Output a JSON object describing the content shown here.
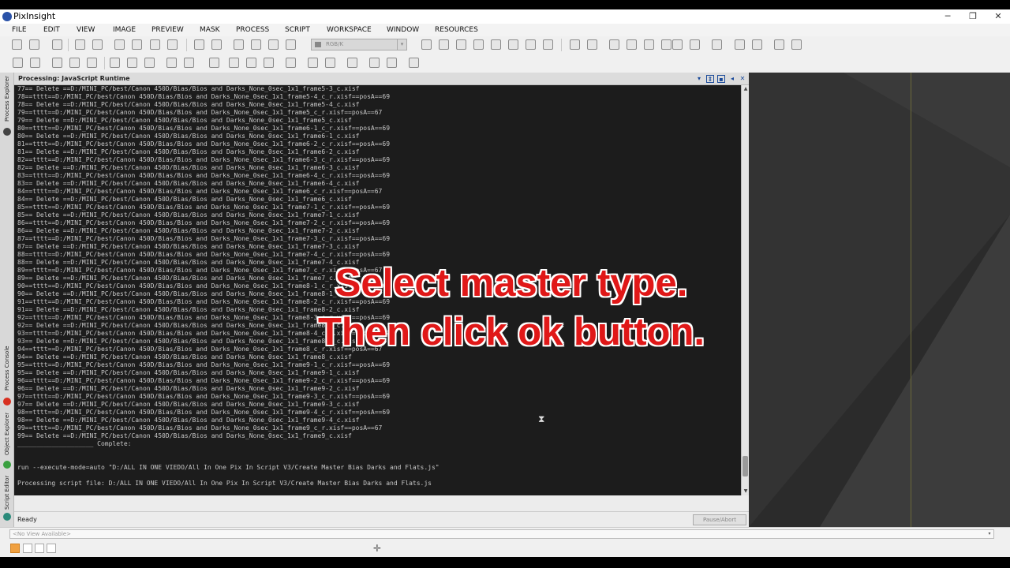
{
  "app": {
    "title": "PixInsight"
  },
  "menu": [
    "FILE",
    "EDIT",
    "VIEW",
    "IMAGE",
    "PREVIEW",
    "MASK",
    "PROCESS",
    "SCRIPT",
    "WORKSPACE",
    "WINDOW",
    "RESOURCES"
  ],
  "toolbar": {
    "color_space": "RGB/K"
  },
  "left_tabs": [
    "Process Explorer",
    "Process Console",
    "Object Explorer",
    "Script Editor"
  ],
  "panel": {
    "title": "Processing: JavaScript Runtime"
  },
  "console_lines": [
    "77== Delete ==D:/MINI_PC/best/Canon 450D/Bias/Bios and Darks_None_0sec_1x1_frame5-3_c.xisf",
    "78==tttt==D:/MINI_PC/best/Canon 450D/Bias/Bios and Darks_None_0sec_1x1_frame5-4_c_r.xisf==posA==69",
    "78== Delete ==D:/MINI_PC/best/Canon 450D/Bias/Bios and Darks_None_0sec_1x1_frame5-4_c.xisf",
    "79==tttt==D:/MINI_PC/best/Canon 450D/Bias/Bios and Darks_None_0sec_1x1_frame5_c_r.xisf==posA==67",
    "79== Delete ==D:/MINI_PC/best/Canon 450D/Bias/Bios and Darks_None_0sec_1x1_frame5_c.xisf",
    "80==tttt==D:/MINI_PC/best/Canon 450D/Bias/Bios and Darks_None_0sec_1x1_frame6-1_c_r.xisf==posA==69",
    "80== Delete ==D:/MINI_PC/best/Canon 450D/Bias/Bios and Darks_None_0sec_1x1_frame6-1_c.xisf",
    "81==tttt==D:/MINI_PC/best/Canon 450D/Bias/Bios and Darks_None_0sec_1x1_frame6-2_c_r.xisf==posA==69",
    "81== Delete ==D:/MINI_PC/best/Canon 450D/Bias/Bios and Darks_None_0sec_1x1_frame6-2_c.xisf",
    "82==tttt==D:/MINI_PC/best/Canon 450D/Bias/Bios and Darks_None_0sec_1x1_frame6-3_c_r.xisf==posA==69",
    "82== Delete ==D:/MINI_PC/best/Canon 450D/Bias/Bios and Darks_None_0sec_1x1_frame6-3_c.xisf",
    "83==tttt==D:/MINI_PC/best/Canon 450D/Bias/Bios and Darks_None_0sec_1x1_frame6-4_c_r.xisf==posA==69",
    "83== Delete ==D:/MINI_PC/best/Canon 450D/Bias/Bios and Darks_None_0sec_1x1_frame6-4_c.xisf",
    "84==tttt==D:/MINI_PC/best/Canon 450D/Bias/Bios and Darks_None_0sec_1x1_frame6_c_r.xisf==posA==67",
    "84== Delete ==D:/MINI_PC/best/Canon 450D/Bias/Bios and Darks_None_0sec_1x1_frame6_c.xisf",
    "85==tttt==D:/MINI_PC/best/Canon 450D/Bias/Bios and Darks_None_0sec_1x1_frame7-1_c_r.xisf==posA==69",
    "85== Delete ==D:/MINI_PC/best/Canon 450D/Bias/Bios and Darks_None_0sec_1x1_frame7-1_c.xisf",
    "86==tttt==D:/MINI_PC/best/Canon 450D/Bias/Bios and Darks_None_0sec_1x1_frame7-2_c_r.xisf==posA==69",
    "86== Delete ==D:/MINI_PC/best/Canon 450D/Bias/Bios and Darks_None_0sec_1x1_frame7-2_c.xisf",
    "87==tttt==D:/MINI_PC/best/Canon 450D/Bias/Bios and Darks_None_0sec_1x1_frame7-3_c_r.xisf==posA==69",
    "87== Delete ==D:/MINI_PC/best/Canon 450D/Bias/Bios and Darks_None_0sec_1x1_frame7-3_c.xisf",
    "88==tttt==D:/MINI_PC/best/Canon 450D/Bias/Bios and Darks_None_0sec_1x1_frame7-4_c_r.xisf==posA==69",
    "88== Delete ==D:/MINI_PC/best/Canon 450D/Bias/Bios and Darks_None_0sec_1x1_frame7-4_c.xisf",
    "89==tttt==D:/MINI_PC/best/Canon 450D/Bias/Bios and Darks_None_0sec_1x1_frame7_c_r.xisf==posA==67",
    "89== Delete ==D:/MINI_PC/best/Canon 450D/Bias/Bios and Darks_None_0sec_1x1_frame7_c.xisf",
    "90==tttt==D:/MINI_PC/best/Canon 450D/Bias/Bios and Darks_None_0sec_1x1_frame8-1_c_r.xisf==posA==69",
    "90== Delete ==D:/MINI_PC/best/Canon 450D/Bias/Bios and Darks_None_0sec_1x1_frame8-1_c.xisf",
    "91==tttt==D:/MINI_PC/best/Canon 450D/Bias/Bios and Darks_None_0sec_1x1_frame8-2_c_r.xisf==posA==69",
    "91== Delete ==D:/MINI_PC/best/Canon 450D/Bias/Bios and Darks_None_0sec_1x1_frame8-2_c.xisf",
    "92==tttt==D:/MINI_PC/best/Canon 450D/Bias/Bios and Darks_None_0sec_1x1_frame8-3_c_r.xisf==posA==69",
    "92== Delete ==D:/MINI_PC/best/Canon 450D/Bias/Bios and Darks_None_0sec_1x1_frame8-3_c.xisf",
    "93==tttt==D:/MINI_PC/best/Canon 450D/Bias/Bios and Darks_None_0sec_1x1_frame8-4_c_r.xisf==posA==69",
    "93== Delete ==D:/MINI_PC/best/Canon 450D/Bias/Bios and Darks_None_0sec_1x1_frame8-4_c.xisf",
    "94==tttt==D:/MINI_PC/best/Canon 450D/Bias/Bios and Darks_None_0sec_1x1_frame8_c_r.xisf==posA==67",
    "94== Delete ==D:/MINI_PC/best/Canon 450D/Bias/Bios and Darks_None_0sec_1x1_frame8_c.xisf",
    "95==tttt==D:/MINI_PC/best/Canon 450D/Bias/Bios and Darks_None_0sec_1x1_frame9-1_c_r.xisf==posA==69",
    "95== Delete ==D:/MINI_PC/best/Canon 450D/Bias/Bios and Darks_None_0sec_1x1_frame9-1_c.xisf",
    "96==tttt==D:/MINI_PC/best/Canon 450D/Bias/Bios and Darks_None_0sec_1x1_frame9-2_c_r.xisf==posA==69",
    "96== Delete ==D:/MINI_PC/best/Canon 450D/Bias/Bios and Darks_None_0sec_1x1_frame9-2_c.xisf",
    "97==tttt==D:/MINI_PC/best/Canon 450D/Bias/Bios and Darks_None_0sec_1x1_frame9-3_c_r.xisf==posA==69",
    "97== Delete ==D:/MINI_PC/best/Canon 450D/Bias/Bios and Darks_None_0sec_1x1_frame9-3_c.xisf",
    "98==tttt==D:/MINI_PC/best/Canon 450D/Bias/Bios and Darks_None_0sec_1x1_frame9-4_c_r.xisf==posA==69",
    "98== Delete ==D:/MINI_PC/best/Canon 450D/Bias/Bios and Darks_None_0sec_1x1_frame9-4_c.xisf",
    "99==tttt==D:/MINI_PC/best/Canon 450D/Bias/Bios and Darks_None_0sec_1x1_frame9_c_r.xisf==posA==67",
    "99== Delete ==D:/MINI_PC/best/Canon 450D/Bias/Bios and Darks_None_0sec_1x1_frame9_c.xisf",
    "____________________ Complete:",
    "",
    "",
    "run --execute-mode=auto \"D:/ALL IN ONE VIEDO/All In One Pix In Script V3/Create Master Bias Darks and Flats.js\"",
    "",
    "Processing script file: D:/ALL IN ONE VIEDO/All In One Pix In Script V3/Create Master Bias Darks and Flats.js"
  ],
  "status": {
    "text": "Ready",
    "pause_label": "Pause/Abort"
  },
  "overlay": {
    "line1": "Select master type.",
    "line2": "Then click ok button."
  },
  "view_selector": {
    "placeholder": "<No View Available>"
  },
  "colors": {
    "overlay_text": "#e01818",
    "console_bg": "#1c1c1c",
    "brand": "#2a52a8"
  }
}
